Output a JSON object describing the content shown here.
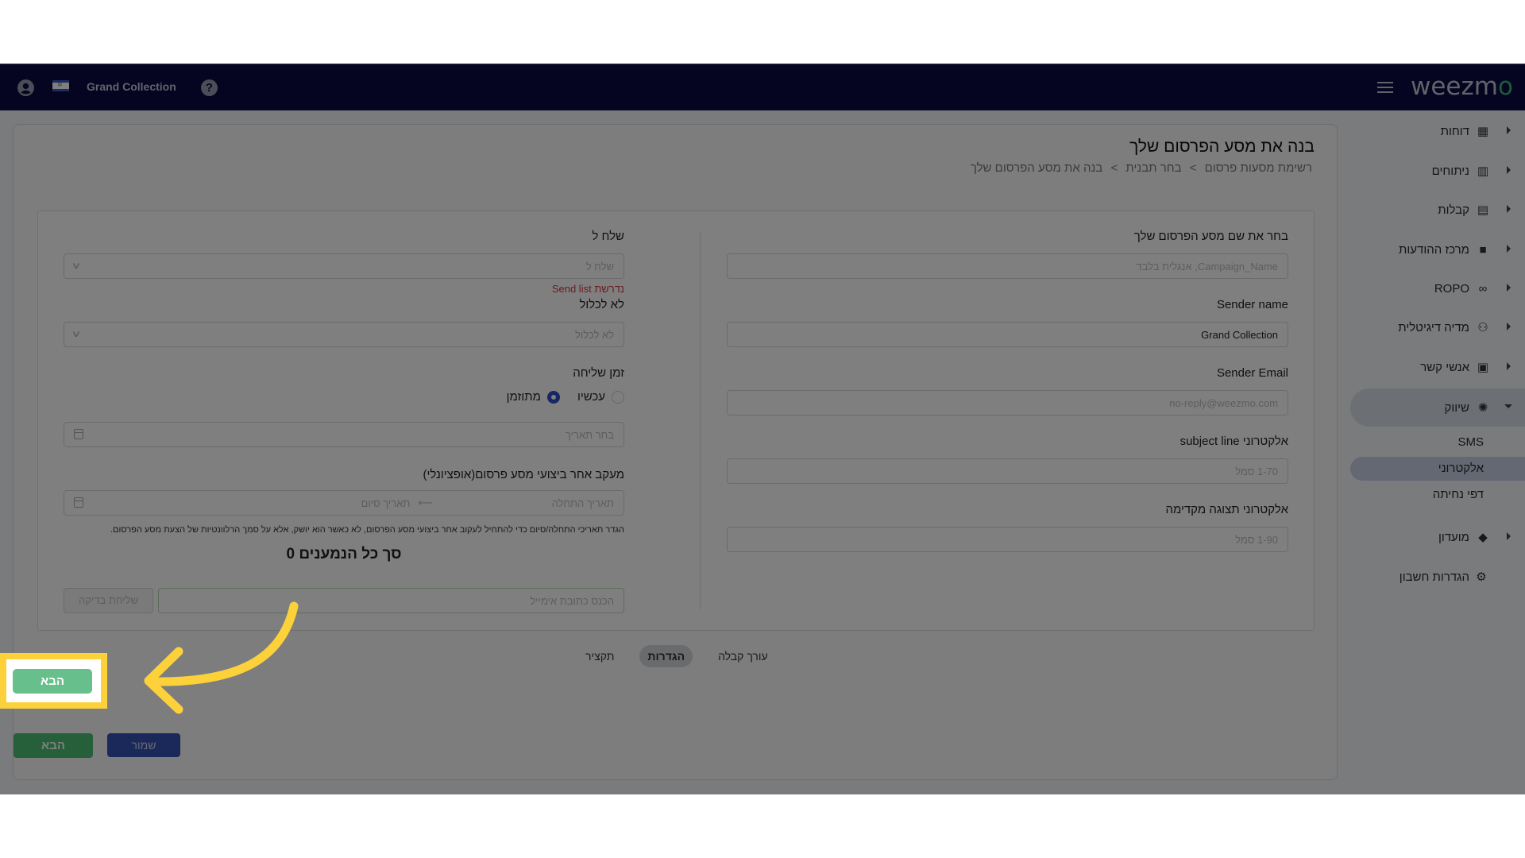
{
  "topbar": {
    "account_name": "Grand Collection",
    "help_glyph": "?",
    "logo_text": "weezm",
    "logo_tail": "o"
  },
  "sidebar": {
    "items": [
      {
        "label": "דוחות",
        "icon": "dashboard-icon",
        "glyph": "▦"
      },
      {
        "label": "ניתוחים",
        "icon": "analytics-icon",
        "glyph": "▥"
      },
      {
        "label": "קבלות",
        "icon": "receipt-icon",
        "glyph": "▤"
      },
      {
        "label": "מרכז ההודעות",
        "icon": "message-icon",
        "glyph": "■"
      },
      {
        "label": "ROPO",
        "icon": "infinity-icon",
        "glyph": "∞"
      },
      {
        "label": "מדיה דיגיטלית",
        "icon": "people-icon",
        "glyph": "⚇"
      },
      {
        "label": "אנשי קשר",
        "icon": "contacts-icon",
        "glyph": "▣"
      },
      {
        "label": "שיווק",
        "icon": "party-popper-icon",
        "glyph": "✺"
      }
    ],
    "marketing_sub": [
      {
        "label": "SMS"
      },
      {
        "label": "אלקטרוני"
      },
      {
        "label": "דפי נחיתה"
      }
    ],
    "club": {
      "label": "מועדון",
      "icon": "tag-icon",
      "glyph": "◆"
    },
    "account_settings": {
      "label": "הגדרות חשבון",
      "icon": "gear-icon",
      "glyph": "⚙"
    }
  },
  "page": {
    "title": "בנה את מסע הפרסום שלך",
    "breadcrumb": [
      "רשימת מסעות פרסום",
      "בחר תבנית",
      "בנה את מסע הפרסום שלך"
    ],
    "breadcrumb_sep": ">"
  },
  "form": {
    "campaign_name": {
      "label": "בחר את שם מסע הפרסום שלך",
      "placeholder": "Campaign_Name, אנגלית בלבד"
    },
    "sender_name": {
      "label": "Sender name",
      "value": "Grand Collection"
    },
    "sender_email": {
      "label": "Sender Email",
      "placeholder": "no-reply@weezmo.com"
    },
    "subject_line": {
      "label": "אלקטרוני subject line",
      "placeholder": "1-70 סמל"
    },
    "preview_text": {
      "label": "אלקטרוני תצוגה מקדימה",
      "placeholder": "1-90 סמל"
    },
    "send_to": {
      "label": "שלח ל",
      "placeholder": "שלח ל",
      "error": "נדרשת Send list"
    },
    "exclude": {
      "label": "לא לכלול",
      "placeholder": "לא לכלול"
    },
    "send_time": {
      "label": "זמן שליחה",
      "options": [
        {
          "label": "עכשיו",
          "checked": false
        },
        {
          "label": "מתוזמן",
          "checked": true
        }
      ],
      "date_placeholder": "בחר תאריך"
    },
    "tracking": {
      "label": "מעקב אחר ביצועי מסע פרסום(אופציונלי)",
      "start_placeholder": "תאריך התחלה",
      "end_placeholder": "תאריך סיום",
      "arrow_glyph": "⟵",
      "help": "הגדר תאריכי התחלה/סיום כדי להתחיל לעקוב אחר ביצועי מסע הפרסום, לא כאשר הוא יושק, אלא על סמך הרלוונטיות של הצעת מסע הפרסום."
    },
    "total_recipients": "סך כל הנמענים 0",
    "test": {
      "email_placeholder": "הכנס כתובת אימייל",
      "button": "שליחת בדיקה"
    }
  },
  "steps": [
    {
      "label": "עורך קבלה",
      "active": false
    },
    {
      "label": "הגדרות",
      "active": true
    },
    {
      "label": "תקציר",
      "active": false
    }
  ],
  "buttons": {
    "save": "שמור",
    "next": "הבא"
  },
  "colors": {
    "topbar": "#0b0a45",
    "accent_blue": "#2d4fc7",
    "next_green": "#4cc077",
    "error_red": "#d9363e",
    "highlight_yellow": "#fdd13a"
  }
}
